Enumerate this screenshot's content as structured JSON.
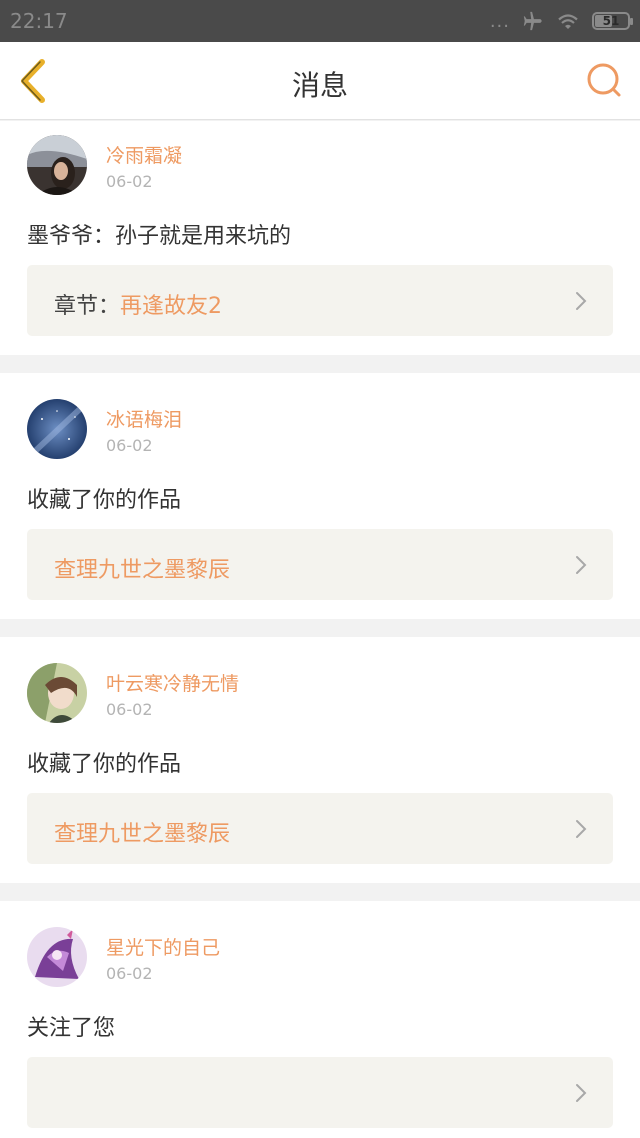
{
  "status_bar": {
    "time": "22:17",
    "dots": "...",
    "battery": "51",
    "battery_level": 0.51
  },
  "nav": {
    "title": "消息",
    "back_icon": "chevron-left-icon",
    "search_icon": "search-icon"
  },
  "colors": {
    "accent": "#ee9a62",
    "back_icon": "#e8b02a",
    "link_box_bg": "#f4f3ee",
    "status_bar_bg": "#4a4a4a"
  },
  "messages": [
    {
      "user": "冷雨霜凝",
      "date": "06-02",
      "text": "墨爷爷：孙子就是用来坑的",
      "link_prefix": "章节：",
      "link_title": "再逢故友2"
    },
    {
      "user": "冰语梅泪",
      "date": "06-02",
      "text": "收藏了你的作品",
      "link_prefix": "",
      "link_title": "查理九世之墨黎辰"
    },
    {
      "user": "叶云寒冷静无情",
      "date": "06-02",
      "text": "收藏了你的作品",
      "link_prefix": "",
      "link_title": "查理九世之墨黎辰"
    },
    {
      "user": "星光下的自己",
      "date": "06-02",
      "text": "关注了您",
      "link_prefix": "",
      "link_title": ""
    }
  ]
}
